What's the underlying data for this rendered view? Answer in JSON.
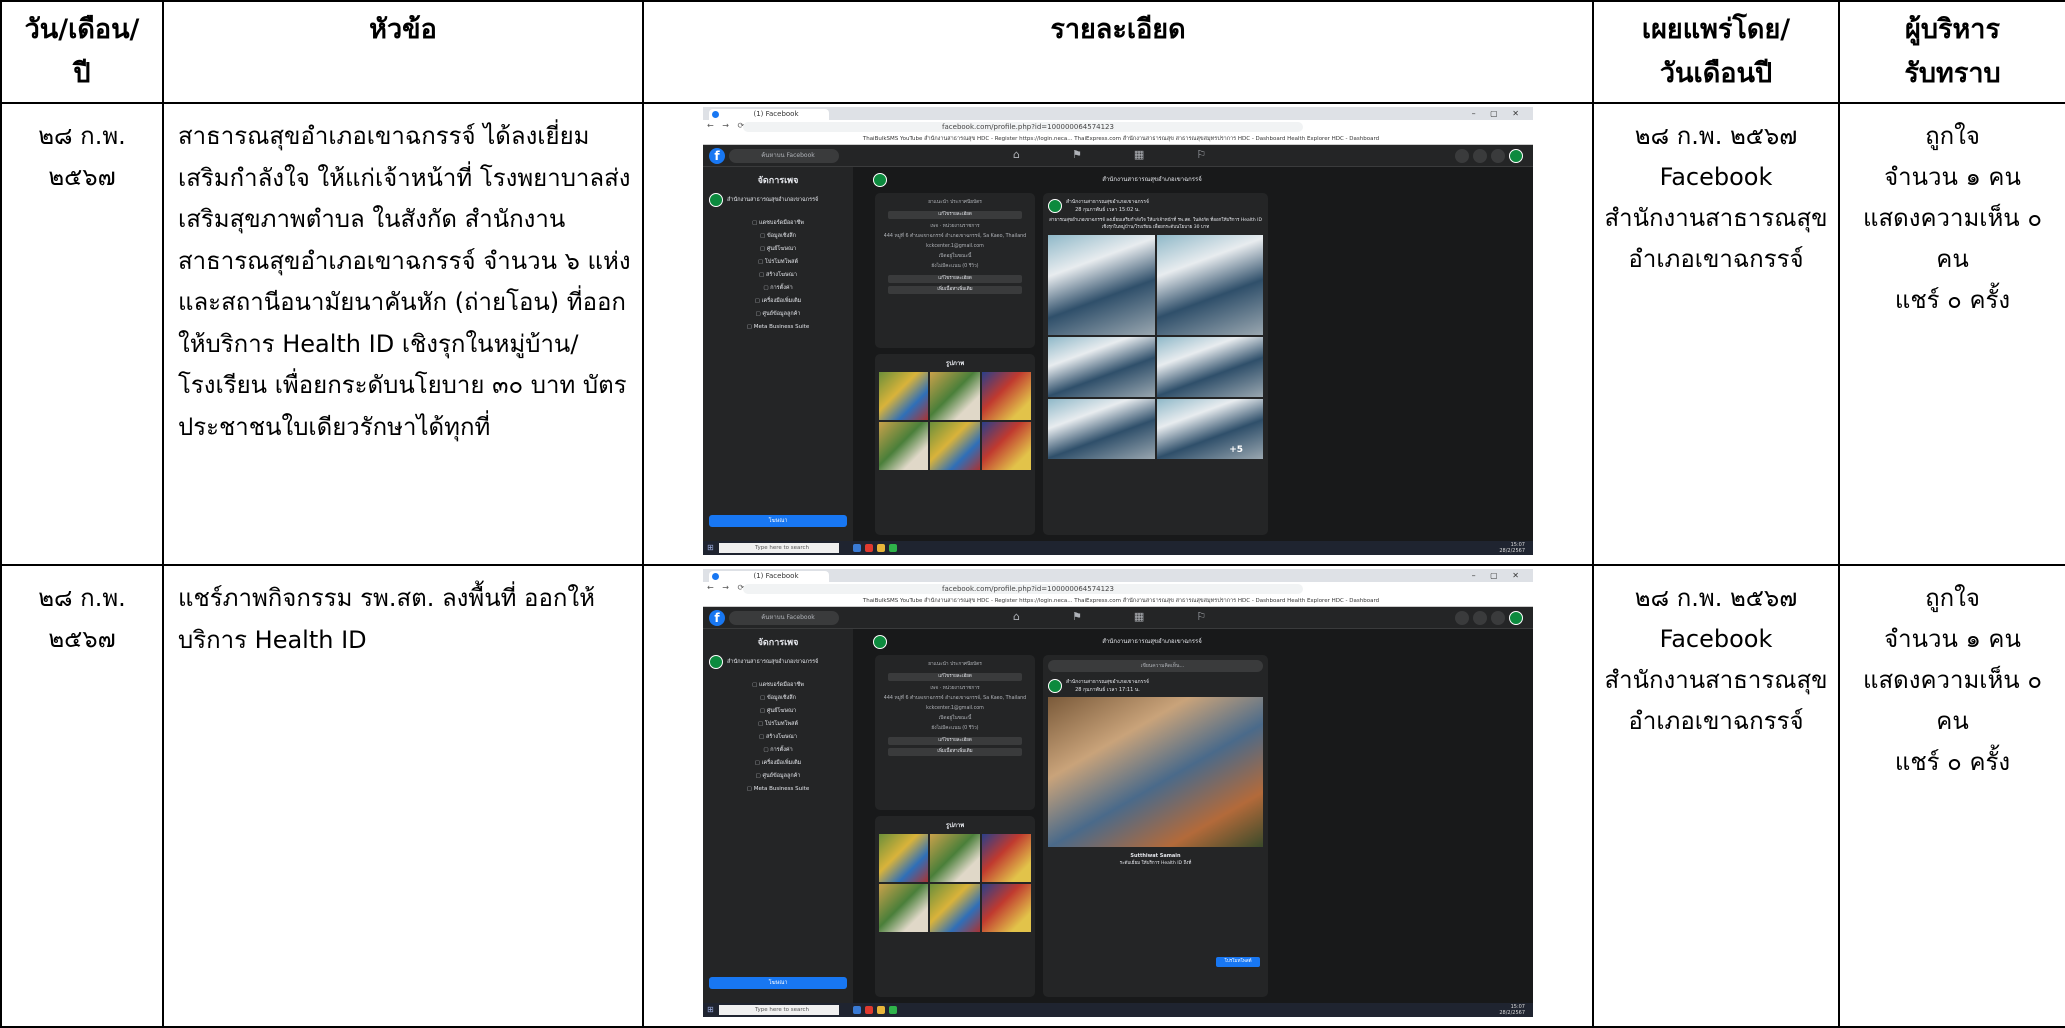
{
  "table": {
    "headers": {
      "date": [
        "วัน/เดือน/",
        "ปี"
      ],
      "topic": "หัวข้อ",
      "detail": "รายละเอียด",
      "publisher": [
        "เผยแพร่โดย/",
        "วันเดือนปี"
      ],
      "ack": [
        "ผู้บริหาร",
        "รับทราบ"
      ]
    },
    "rows": [
      {
        "date": [
          "๒๘ ก.พ.",
          "๒๕๖๗"
        ],
        "topic": "สาธารณสุขอำเภอเขาฉกรรจ์ ได้ลงเยี่ยมเสริมกำลังใจ ให้แก่เจ้าหน้าที่ โรงพยาบาลส่งเสริมสุขภาพตำบล ในสังกัด สำนักงานสาธารณสุขอำเภอเขาฉกรรจ์ จำนวน ๖ แห่ง และสถานีอนามัยนาคันหัก (ถ่ายโอน) ที่ออกให้บริการ Health ID  เชิงรุกในหมู่บ้าน/โรงเรียน เพื่อยกระดับนโยบาย ๓๐ บาท บัตรประชาชนใบเดียวรักษาได้ทุกที่",
        "publisher": [
          "๒๘ ก.พ. ๒๕๖๗",
          "Facebook",
          "สำนักงานสาธารณสุข",
          "อำเภอเขาฉกรรจ์"
        ],
        "ack": [
          "ถูกใจ",
          "จำนวน ๑ คน",
          "แสดงความเห็น ๐",
          "คน",
          "แชร์ ๐ ครั้ง"
        ]
      },
      {
        "date": [
          "๒๘ ก.พ.",
          "๒๕๖๗"
        ],
        "topic": "แชร์ภาพกิจกรรม รพ.สต. ลงพื้นที่ ออกให้บริการ Health ID",
        "publisher": [
          "๒๘ ก.พ. ๒๕๖๗",
          "Facebook",
          "สำนักงานสาธารณสุข",
          "อำเภอเขาฉกรรจ์"
        ],
        "ack": [
          "ถูกใจ",
          "จำนวน ๑ คน",
          "แสดงความเห็น ๐",
          "คน",
          "แชร์ ๐ ครั้ง"
        ]
      }
    ]
  },
  "screenshot": {
    "tab_title": "(1) Facebook",
    "window_controls": "–  ▢  ✕",
    "nav": "←  →  ⟳",
    "address": "facebook.com/profile.php?id=100000064574123",
    "bookmarks": "ThaiBulkSMS  YouTube  สำนักงานสาธารณสุข  HDC - Register  https://login.neca...  ThaiExpress.com  สำนักงานสาธารณสุข  สาธารณสุขสมุทรปราการ  HDC - Dashboard  Health Explorer  HDC - Dashboard",
    "fb_logo": "f",
    "fb_search": "ค้นหาบน Facebook",
    "fb_nav_icons": "⌂⚑▦⚐",
    "left_title": "จัดการเพจ",
    "page_name": "สำนักงานสาธารณสุขอำเภอเขาฉกรรจ์",
    "left_items": [
      "แดชบอร์ดมืออาชีพ",
      "ข้อมูลเชิงลึก",
      "ศูนย์โฆษณา",
      "โปรโมทโพสต์",
      "สร้างโฆษณา",
      "การตั้งค่า",
      "เครื่องมือเพิ่มเติม",
      "ศูนย์ข้อมูลลูกค้า",
      "Meta Business Suite"
    ],
    "left_button": "โฆษณา",
    "about_lines": [
      "ยาแนะนำ ประกาศนียบัตร",
      "เพจ · หน่วยงานราชการ",
      "444 หมู่ที่ 6 ตำบลเขาฉกรรจ์ อำเภอเขาฉกรรจ์, Sa Kaeo, Thailand",
      "kckcenter.1@gmail.com",
      "เปิดอยู่ในขณะนี้",
      "ยังไม่มีคะแนน (0 รีวิว)"
    ],
    "about_buttons": [
      "แก้ไขรายละเอียด",
      "เพิ่มเนื้อหาเพิ่มเติม"
    ],
    "photos_title": "รูปภาพ",
    "post1_author": "สำนักงานสาธารณสุขอำเภอเขาฉกรรจ์",
    "post1_time": "28 กุมภาพันธ์ เวลา 15:02 น.",
    "post1_text": "สาธารณสุขอำเภอเขาฉกรรจ์ ลงเยี่ยมเสริมกำลังใจ ให้แก่เจ้าหน้าที่ รพ.สต. ในสังกัด ที่ออกให้บริการ Health ID เชิงรุกในหมู่บ้าน/โรงเรียน เพื่อยกระดับนโยบาย 30 บาท",
    "post1_more": "+5",
    "post2_status": "เขียนความคิดเห็น...",
    "post2_author": "สำนักงานสาธารณสุขอำเภอเขาฉกรรจ์",
    "post2_time": "28 กุมภาพันธ์ เวลา 17:11 น.",
    "post2_commenter": "Sutthiwat Samain",
    "post2_comment": "ระดับเยี่ยม ให้บริการ Health ID ถึงที่",
    "post2_send": "โปรโมทโพสต์",
    "taskbar_search": "Type here to search",
    "taskbar_clock": [
      "15:07",
      "28/2/2567"
    ]
  }
}
